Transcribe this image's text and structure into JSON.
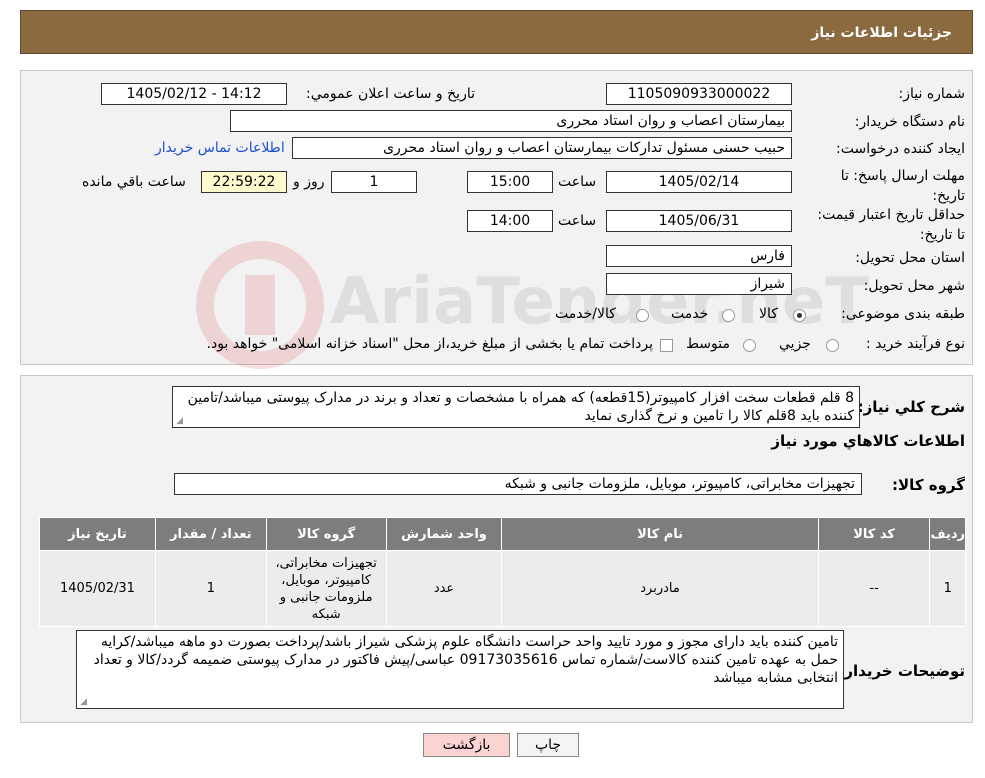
{
  "header": {
    "title": "جزئیات اطلاعات نیاز"
  },
  "form": {
    "need_number": {
      "label": "شماره نیاز:",
      "value": "1105090933000022"
    },
    "announce_datetime": {
      "label": "تاریخ و ساعت اعلان عمومي:",
      "value": "1405/02/12 - 14:12"
    },
    "buyer_org": {
      "label": "نام دستگاه خریدار:",
      "value": "بیمارستان اعصاب و روان استاد محرری"
    },
    "requester": {
      "label": "ایجاد کننده درخواست:",
      "value": "حبیب حسنی مسئول تدارکات بیمارستان اعصاب و روان استاد محرری",
      "contact_link": "اطلاعات تماس خریدار"
    },
    "response_deadline": {
      "label": "مهلت ارسال پاسخ: تا تاریخ:",
      "date": "1405/02/14",
      "time_label": "ساعت",
      "time": "15:00",
      "days": "1",
      "days_label": "روز و",
      "remaining": "22:59:22",
      "remaining_label": "ساعت باقي مانده"
    },
    "price_validity": {
      "label": "حداقل تاریخ اعتبار قیمت: تا تاریخ:",
      "date": "1405/06/31",
      "time_label": "ساعت",
      "time": "14:00"
    },
    "province": {
      "label": "استان محل تحویل:",
      "value": "فارس"
    },
    "city": {
      "label": "شهر محل تحویل:",
      "value": "شیراز"
    },
    "category": {
      "label": "طبقه بندی موضوعی:",
      "options": [
        "کالا",
        "خدمت",
        "کالا/خدمت"
      ],
      "selected": "کالا"
    },
    "purchase_type": {
      "label": "نوع فرآیند خرید :",
      "options": [
        "جزیي",
        "متوسط"
      ],
      "note": "پرداخت تمام یا بخشی از مبلغ خرید،از محل \"اسناد خزانه اسلامی\" خواهد بود."
    }
  },
  "details": {
    "description_label": "شرح كلي نیاز:",
    "description": "8 قلم قطعات سخت افزار کامپیوتر(15قطعه) که همراه با مشخصات و تعداد و برند در مدارک پیوستی میباشد/تامین کننده باید 8قلم کالا را تامین و نرخ گذاری نماید",
    "goods_info_title": "اطلاعات کالاهاي مورد نیاز",
    "goods_group_label": "گروه کالا:",
    "goods_group": "تجهیزات مخابراتی، کامپیوتر، موبایل، ملزومات جانبی و شبکه",
    "table": {
      "headers": [
        "ردیف",
        "کد کالا",
        "نام کالا",
        "واحد شمارش",
        "گروه کالا",
        "تعداد / مقدار",
        "تاریخ نیاز"
      ],
      "rows": [
        [
          "1",
          "--",
          "مادربرد",
          "عدد",
          "تجهیزات مخابراتی، کامپیوتر، موبایل، ملزومات جانبی و شبکه",
          "1",
          "1405/02/31"
        ]
      ]
    },
    "buyer_notes_label": "توضیحات خریدار:",
    "buyer_notes": "تامین کننده باید دارای مجوز و مورد تایید واحد حراست دانشگاه علوم پزشکی شیراز باشد/پرداخت بصورت دو ماهه میباشد/کرایه حمل به عهده تامین کننده کالاست/شماره تماس 09173035616  عباسی/پیش فاکتور در مدارک پیوستی ضمیمه گردد/کالا و تعداد انتخابی مشابه میباشد"
  },
  "buttons": {
    "print": "چاپ",
    "back": "بازگشت"
  },
  "watermark": {
    "text": "AriaTender.neT"
  }
}
